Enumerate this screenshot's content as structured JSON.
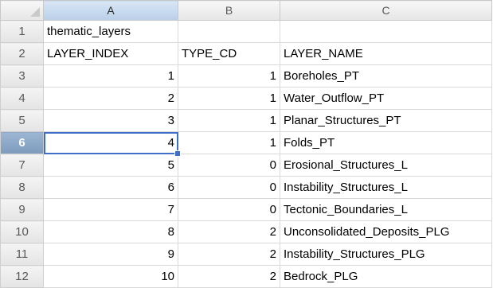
{
  "columns": [
    "A",
    "B",
    "C"
  ],
  "active_column": "A",
  "active_row": "6",
  "row_numbers": [
    "1",
    "2",
    "3",
    "4",
    "5",
    "6",
    "7",
    "8",
    "9",
    "10",
    "11",
    "12"
  ],
  "rows": [
    [
      "thematic_layers",
      "",
      ""
    ],
    [
      "LAYER_INDEX",
      "TYPE_CD",
      "LAYER_NAME"
    ],
    [
      "1",
      "1",
      "Boreholes_PT"
    ],
    [
      "2",
      "1",
      "Water_Outflow_PT"
    ],
    [
      "3",
      "1",
      "Planar_Structures_PT"
    ],
    [
      "4",
      "1",
      "Folds_PT"
    ],
    [
      "5",
      "0",
      "Erosional_Structures_L"
    ],
    [
      "6",
      "0",
      "Instability_Structures_L"
    ],
    [
      "7",
      "0",
      "Tectonic_Boundaries_L"
    ],
    [
      "8",
      "2",
      "Unconsolidated_Deposits_PLG"
    ],
    [
      "9",
      "2",
      "Instability_Structures_PLG"
    ],
    [
      "10",
      "2",
      "Bedrock_PLG"
    ]
  ],
  "selected_cell": "A6",
  "colors": {
    "selection_border": "#3d6fc7",
    "active_row_header": "#7d9bbd",
    "active_col_header": "#b9cfe8",
    "gridline": "#d9d9d9"
  }
}
